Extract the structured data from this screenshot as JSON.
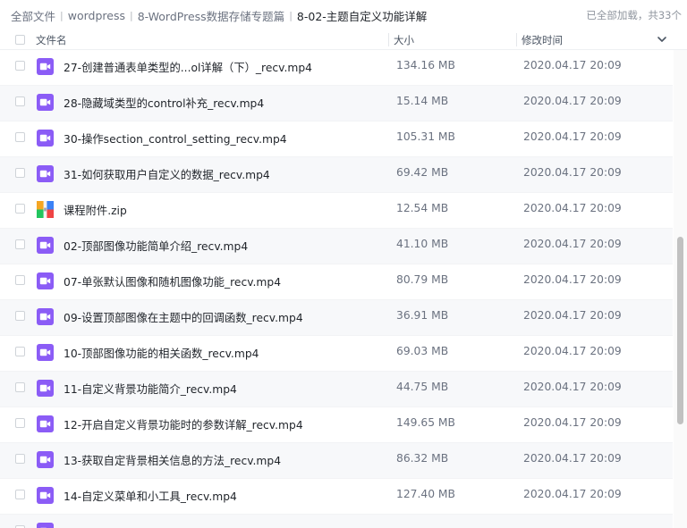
{
  "breadcrumb": [
    "全部文件",
    "wordpress",
    "8-WordPress数据存储专题篇",
    "8-02-主题自定义功能详解"
  ],
  "load_status": "已全部加载，共33个",
  "columns": {
    "name": "文件名",
    "size": "大小",
    "time": "修改时间"
  },
  "files": [
    {
      "name": "27-创建普通表单类型的...ol详解（下）_recv.mp4",
      "size": "134.16 MB",
      "time": "2020.04.17 20:09",
      "icon": "video-file-icon"
    },
    {
      "name": "28-隐藏域类型的control补充_recv.mp4",
      "size": "15.14 MB",
      "time": "2020.04.17 20:09",
      "icon": "video-file-icon"
    },
    {
      "name": "30-操作section_control_setting_recv.mp4",
      "size": "105.31 MB",
      "time": "2020.04.17 20:09",
      "icon": "video-file-icon"
    },
    {
      "name": "31-如何获取用户自定义的数据_recv.mp4",
      "size": "69.42 MB",
      "time": "2020.04.17 20:09",
      "icon": "video-file-icon"
    },
    {
      "name": "课程附件.zip",
      "size": "12.54 MB",
      "time": "2020.04.17 20:09",
      "icon": "zip-file-icon"
    },
    {
      "name": "02-顶部图像功能简单介绍_recv.mp4",
      "size": "41.10 MB",
      "time": "2020.04.17 20:09",
      "icon": "video-file-icon"
    },
    {
      "name": "07-单张默认图像和随机图像功能_recv.mp4",
      "size": "80.79 MB",
      "time": "2020.04.17 20:09",
      "icon": "video-file-icon"
    },
    {
      "name": "09-设置顶部图像在主题中的回调函数_recv.mp4",
      "size": "36.91 MB",
      "time": "2020.04.17 20:09",
      "icon": "video-file-icon"
    },
    {
      "name": "10-顶部图像功能的相关函数_recv.mp4",
      "size": "69.03 MB",
      "time": "2020.04.17 20:09",
      "icon": "video-file-icon"
    },
    {
      "name": "11-自定义背景功能简介_recv.mp4",
      "size": "44.75 MB",
      "time": "2020.04.17 20:09",
      "icon": "video-file-icon"
    },
    {
      "name": "12-开启自定义背景功能时的参数详解_recv.mp4",
      "size": "149.65 MB",
      "time": "2020.04.17 20:09",
      "icon": "video-file-icon"
    },
    {
      "name": "13-获取自定背景相关信息的方法_recv.mp4",
      "size": "86.32 MB",
      "time": "2020.04.17 20:09",
      "icon": "video-file-icon"
    },
    {
      "name": "14-自定义菜单和小工具_recv.mp4",
      "size": "127.40 MB",
      "time": "2020.04.17 20:09",
      "icon": "video-file-icon"
    },
    {
      "name": "",
      "size": "",
      "time": "",
      "icon": "video-file-icon"
    }
  ],
  "colors": {
    "video_icon": "#8b5cf6",
    "text": "#1f2329",
    "muted": "#6b7280",
    "alt_row": "#f7f8fa"
  }
}
